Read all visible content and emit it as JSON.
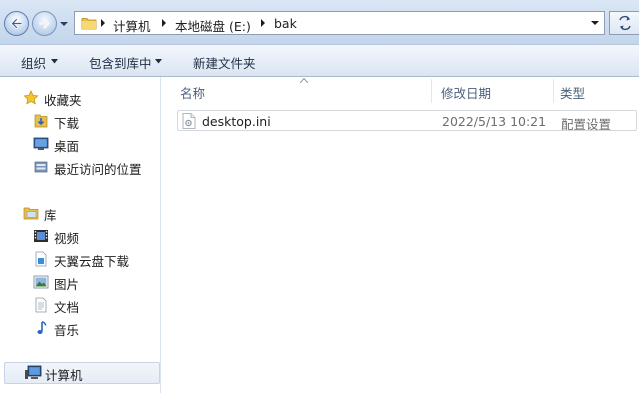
{
  "address_bar": {
    "breadcrumbs": [
      "计算机",
      "本地磁盘 (E:)",
      "bak"
    ]
  },
  "toolbar": {
    "organize": "组织",
    "include_in_library": "包含到库中",
    "new_folder": "新建文件夹"
  },
  "nav": {
    "favorites": {
      "label": "收藏夹",
      "items": [
        "下载",
        "桌面",
        "最近访问的位置"
      ]
    },
    "libraries": {
      "label": "库",
      "items": [
        "视频",
        "天翼云盘下载",
        "图片",
        "文档",
        "音乐"
      ]
    },
    "computer": {
      "label": "计算机"
    }
  },
  "columns": {
    "name": "名称",
    "modified": "修改日期",
    "type": "类型"
  },
  "files": [
    {
      "name": "desktop.ini",
      "modified": "2022/5/13 10:21",
      "type": "配置设置"
    }
  ],
  "icons": {
    "back": "back-arrow-icon",
    "forward": "forward-arrow-icon",
    "refresh": "refresh-icon",
    "folder": "folder-icon",
    "file": "ini-file-icon"
  },
  "colors": {
    "chrome_gradient_top": "#dbe7f5",
    "toolbar_text": "#1e2e46",
    "header_text": "#4c607a",
    "secondary_text": "#6d6d6d"
  }
}
